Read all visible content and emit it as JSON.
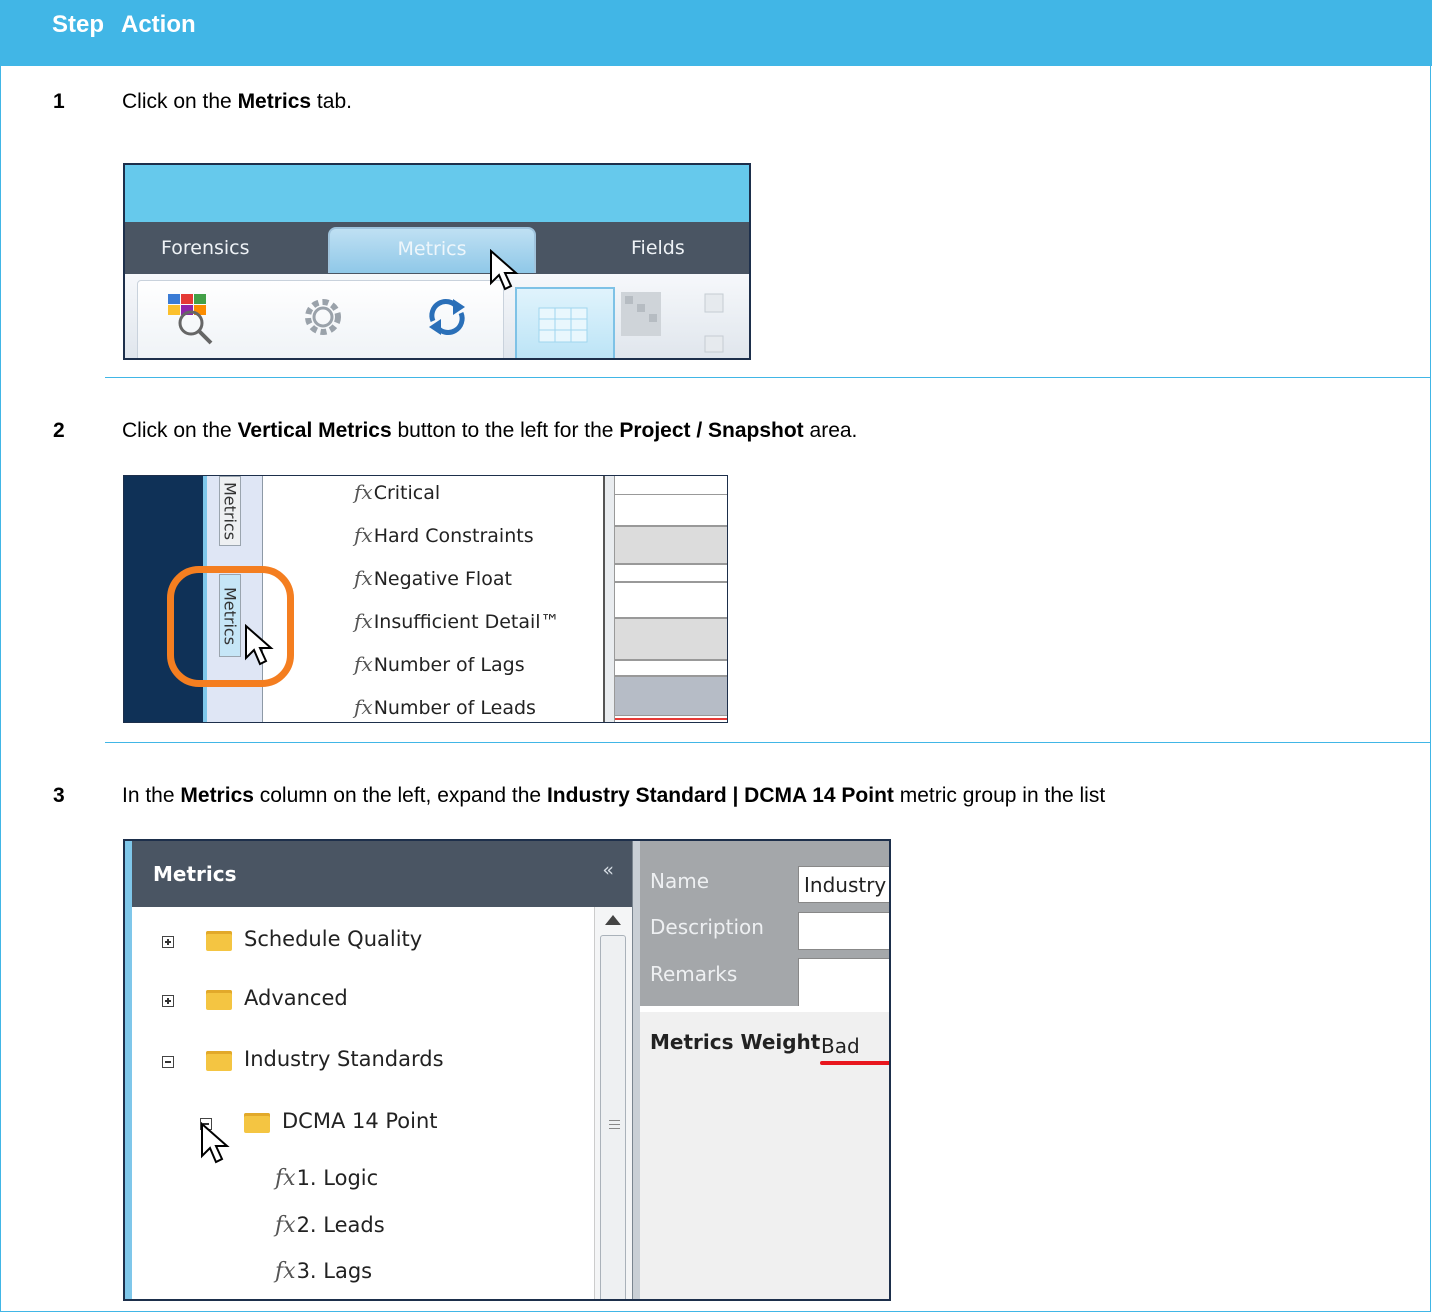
{
  "header": {
    "step": "Step",
    "action": "Action"
  },
  "steps": [
    {
      "num": "1",
      "text_before": "Click on the ",
      "bold1": "Metrics",
      "text_after": " tab.",
      "screenshot": {
        "tabs": [
          "Forensics",
          "Metrics",
          "Fields"
        ],
        "selected_tab": "Metrics"
      }
    },
    {
      "num": "2",
      "text_before": "Click on the ",
      "bold1": "Vertical Metrics",
      "text_mid": " button to the left for the ",
      "bold2": "Project / Snapshot",
      "text_after": " area.",
      "screenshot": {
        "vertical_tabs": [
          "Metrics",
          "Metrics"
        ],
        "fx_items": [
          "Critical",
          "Hard Constraints",
          "Negative Float",
          "Insufficient Detail™",
          "Number of Lags",
          "Number of Leads"
        ],
        "highlight_color": "#f47e20"
      }
    },
    {
      "num": "3",
      "text_before": "In the ",
      "bold1": "Metrics",
      "text_mid": " column on the left, expand the ",
      "bold2": "Industry Standard | DCMA 14 Point",
      "text_after": " metric group in the list",
      "screenshot": {
        "panel_title": "Metrics",
        "collapse_icon": "«",
        "tree": [
          {
            "label": "Schedule Quality",
            "expander": "plus"
          },
          {
            "label": "Advanced",
            "expander": "plus"
          },
          {
            "label": "Industry Standards",
            "expander": "minus",
            "selected": true
          },
          {
            "label": "DCMA 14 Point",
            "expander": "minus"
          }
        ],
        "fx_items": [
          "1. Logic",
          "2. Leads",
          "3. Lags"
        ],
        "props": {
          "name_label": "Name",
          "name_value": "Industry",
          "description_label": "Description",
          "remarks_label": "Remarks"
        },
        "weight_label": "Metrics Weight",
        "weight_value": "Bad"
      }
    }
  ],
  "colors": {
    "header_bg": "#41b6e6",
    "border": "#41b6e6",
    "navy": "#0f3157"
  }
}
